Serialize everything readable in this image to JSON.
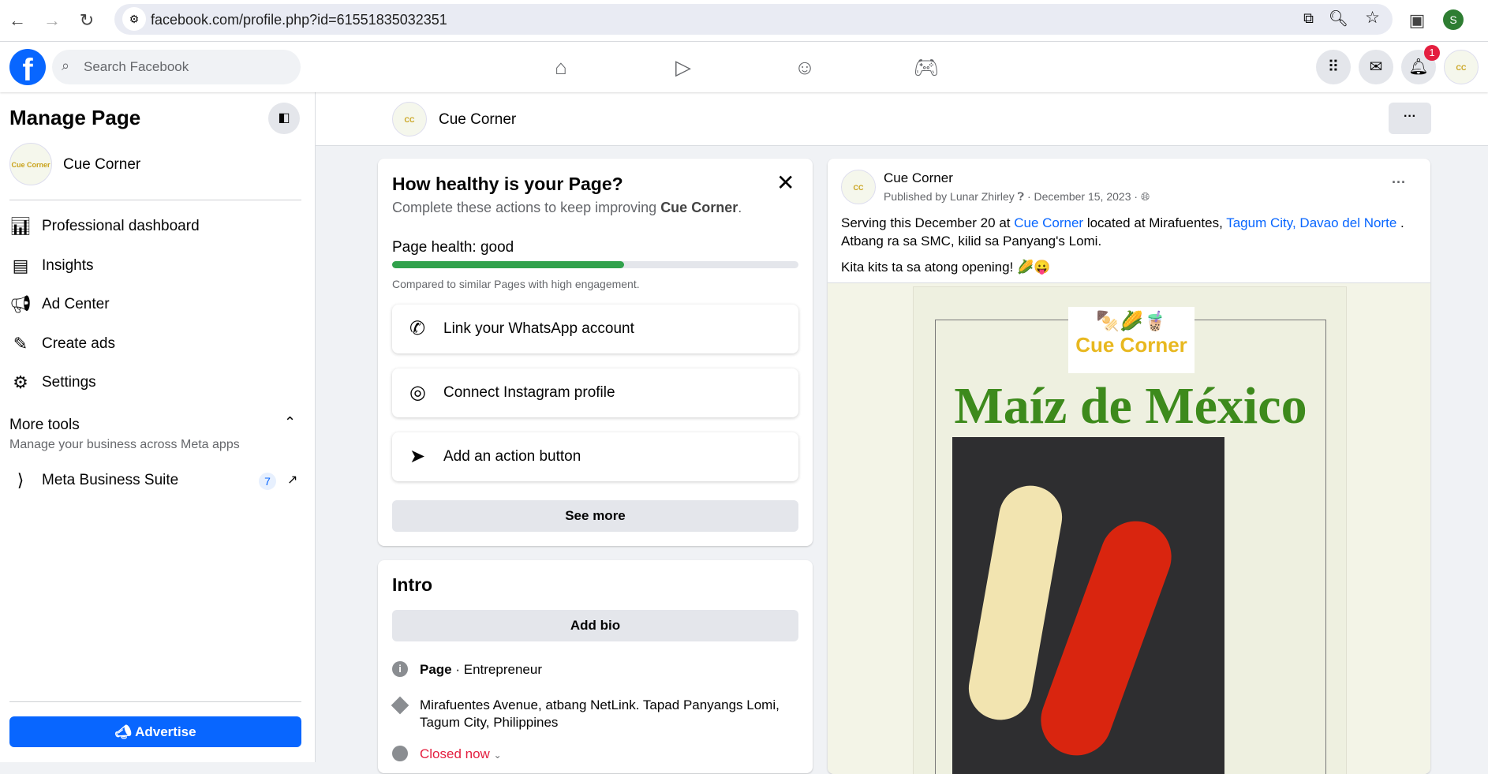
{
  "browser": {
    "url": "facebook.com/profile.php?id=61551835032351",
    "profile_initial": "S"
  },
  "header": {
    "search_placeholder": "Search Facebook",
    "notification_count": "1"
  },
  "sidebar": {
    "title": "Manage Page",
    "page_name": "Cue Corner",
    "items": [
      {
        "label": "Professional dashboard",
        "icon": "chart-icon"
      },
      {
        "label": "Insights",
        "icon": "insights-icon"
      },
      {
        "label": "Ad Center",
        "icon": "megaphone-icon"
      },
      {
        "label": "Create ads",
        "icon": "edit-icon"
      },
      {
        "label": "Settings",
        "icon": "gear-icon"
      }
    ],
    "more_tools": {
      "title": "More tools",
      "subtitle": "Manage your business across Meta apps"
    },
    "meta_suite": {
      "label": "Meta Business Suite",
      "count": "7"
    },
    "advertise": "Advertise"
  },
  "page_header": {
    "name": "Cue Corner",
    "more": "···"
  },
  "health": {
    "title": "How healthy is your Page?",
    "subtitle_pre": "Complete these actions to keep improving ",
    "subtitle_page": "Cue Corner",
    "subtitle_end": ".",
    "status": "Page health: good",
    "progress_percent": 57,
    "compare": "Compared to similar Pages with high engagement.",
    "actions": [
      "Link your WhatsApp account",
      "Connect Instagram profile",
      "Add an action button"
    ],
    "see_more": "See more"
  },
  "intro": {
    "title": "Intro",
    "add_bio": "Add bio",
    "category_label": "Page",
    "category": " · Entrepreneur",
    "address": "Mirafuentes Avenue, atbang NetLink. Tapad Panyangs Lomi, Tagum City, Philippines",
    "hours": "Closed now"
  },
  "post": {
    "author": "Cue Corner",
    "published": "Published by Lunar Zhirley",
    "date": " · December 15, 2023 · ",
    "t1": "Serving this December 20 at ",
    "link1": "Cue Corner",
    "t2": " located at Mirafuentes, ",
    "link2": "Tagum City, Davao del Norte",
    "t3": " .",
    "line2": "Atbang ra sa SMC, kilid sa Panyang's Lomi.",
    "line3": "Kita kits ta sa atong opening! 🌽😛",
    "image_brand": "Cue Corner",
    "image_title": "Maíz de México"
  }
}
